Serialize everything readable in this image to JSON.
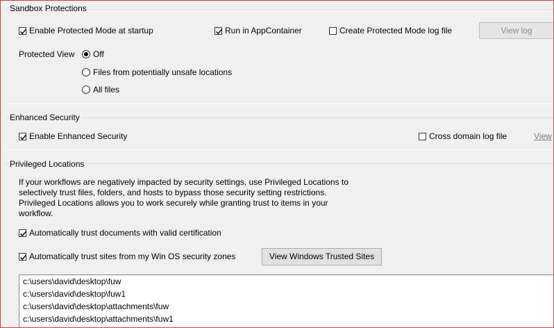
{
  "sandbox": {
    "title": "Sandbox Protections",
    "enable_protected_mode": {
      "label": "Enable Protected Mode at startup",
      "checked": true
    },
    "run_in_appcontainer": {
      "label": "Run in AppContainer",
      "checked": true
    },
    "create_log": {
      "label": "Create Protected Mode log file",
      "checked": false
    },
    "view_log_button": "View log",
    "protected_view_label": "Protected View",
    "protected_view_options": [
      {
        "label": "Off",
        "selected": true
      },
      {
        "label": "Files from potentially unsafe locations",
        "selected": false
      },
      {
        "label": "All files",
        "selected": false
      }
    ]
  },
  "enhanced": {
    "title": "Enhanced Security",
    "enable_enhanced": {
      "label": "Enable Enhanced Security",
      "checked": true
    },
    "cross_domain_log": {
      "label": "Cross domain log file",
      "checked": false
    },
    "view_link": "View"
  },
  "privileged": {
    "title": "Privileged Locations",
    "description_lines": [
      "If your workflows are negatively impacted by security settings, use Privileged Locations to",
      "selectively trust files, folders, and hosts to bypass those security setting restrictions.",
      "Privileged Locations allows you to work securely while granting trust to items in your",
      "workflow."
    ],
    "trust_certified": {
      "label": "Automatically trust documents with valid certification",
      "checked": true
    },
    "trust_win_zones": {
      "label": "Automatically trust sites from my Win OS security zones",
      "checked": true
    },
    "view_trusted_sites_button": "View Windows Trusted Sites",
    "locations": [
      "c:\\users\\david\\desktop\\fuw",
      "c:\\users\\david\\desktop\\fuw1",
      "c:\\users\\david\\desktop\\attachments\\fuw",
      "c:\\users\\david\\desktop\\attachments\\fuw1"
    ]
  }
}
